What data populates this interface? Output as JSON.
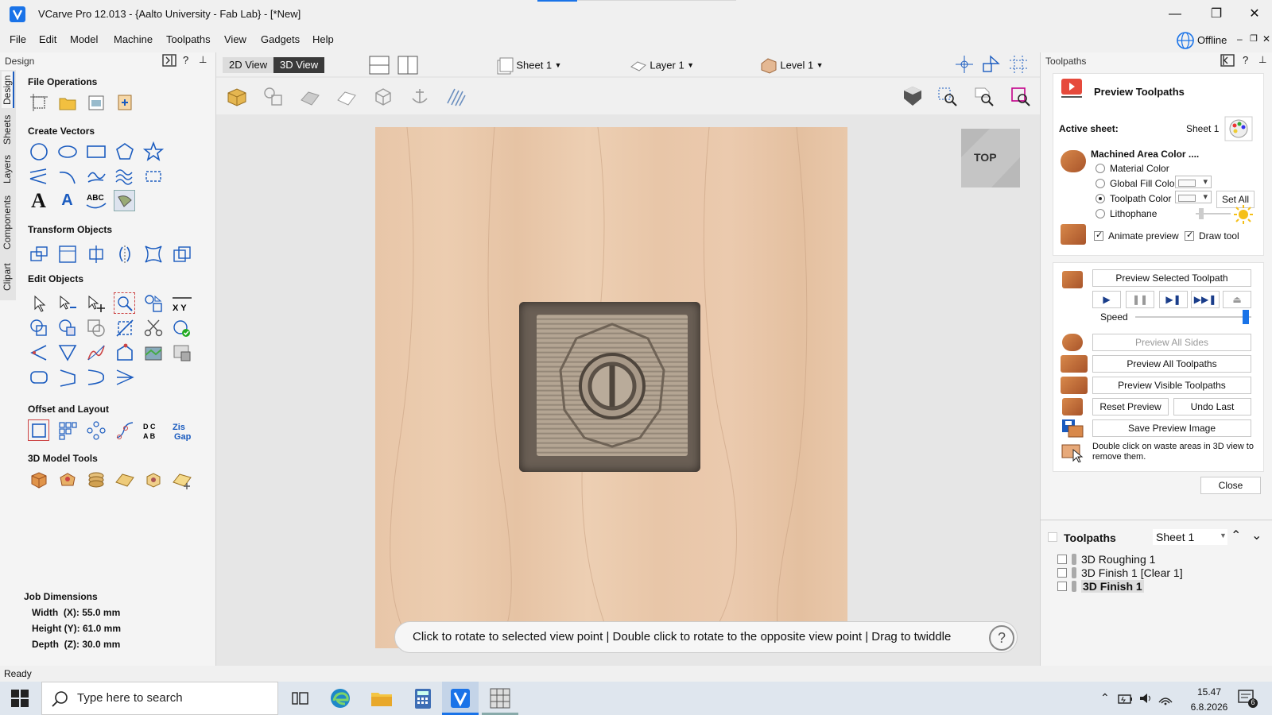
{
  "window": {
    "title": "VCarve Pro 12.013 - {Aalto University - Fab Lab} - [*New]",
    "minimize": "—",
    "maximize": "❐",
    "close": "✕"
  },
  "menu": [
    "File",
    "Edit",
    "Model",
    "Machine",
    "Toolpaths",
    "View",
    "Gadgets",
    "Help"
  ],
  "offline": {
    "label": "Offline"
  },
  "left_panel": {
    "header": "Design",
    "vertical_tabs": [
      "Design",
      "Sheets",
      "Layers",
      "Components",
      "Clipart"
    ],
    "sections": [
      "File Operations",
      "Create Vectors",
      "Transform Objects",
      "Edit Objects",
      "Offset and Layout",
      "3D Model Tools"
    ],
    "job_dimensions": {
      "title": "Job Dimensions",
      "width": "Width  (X): 55.0 mm",
      "height": "Height (Y): 61.0 mm",
      "depth": "Depth  (Z): 30.0 mm"
    }
  },
  "view": {
    "tab_2d": "2D View",
    "tab_3d": "3D View",
    "sheet": "Sheet 1",
    "layer": "Layer 1",
    "level": "Level 1",
    "cube_label": "TOP",
    "hint": "Click to rotate to selected view point | Double click to rotate to the opposite view point | Drag to twiddle",
    "help": "?"
  },
  "right_panel": {
    "header": "Toolpaths",
    "preview_title": "Preview Toolpaths",
    "active_sheet_label": "Active sheet:",
    "active_sheet_value": "Sheet 1",
    "machined_area": "Machined Area Color ....",
    "material_color": "Material Color",
    "global_fill": "Global Fill Color",
    "toolpath_color": "Toolpath Color",
    "set_all": "Set All",
    "lithophane": "Lithophane",
    "animate_preview": "Animate preview",
    "draw_tool": "Draw tool",
    "preview_selected": "Preview Selected Toolpath",
    "speed_label": "Speed",
    "speed_fraction": 0.95,
    "preview_all_sides": "Preview All Sides",
    "preview_all_toolpaths": "Preview All Toolpaths",
    "preview_visible": "Preview Visible Toolpaths",
    "reset_preview": "Reset Preview",
    "undo_last": "Undo Last",
    "save_preview_image": "Save Preview Image",
    "waste_note": "Double click on waste areas in 3D view to remove them.",
    "close": "Close",
    "list_title": "Toolpaths",
    "list_sheet": "Sheet 1",
    "toolpaths": [
      "3D Roughing 1",
      "3D Finish 1 [Clear 1]",
      "3D Finish 1"
    ]
  },
  "statusbar": {
    "text": "Ready"
  },
  "taskbar": {
    "search_placeholder": "Type here to search",
    "time": "15.47",
    "date": "6.8.2026",
    "notifications": "6"
  }
}
